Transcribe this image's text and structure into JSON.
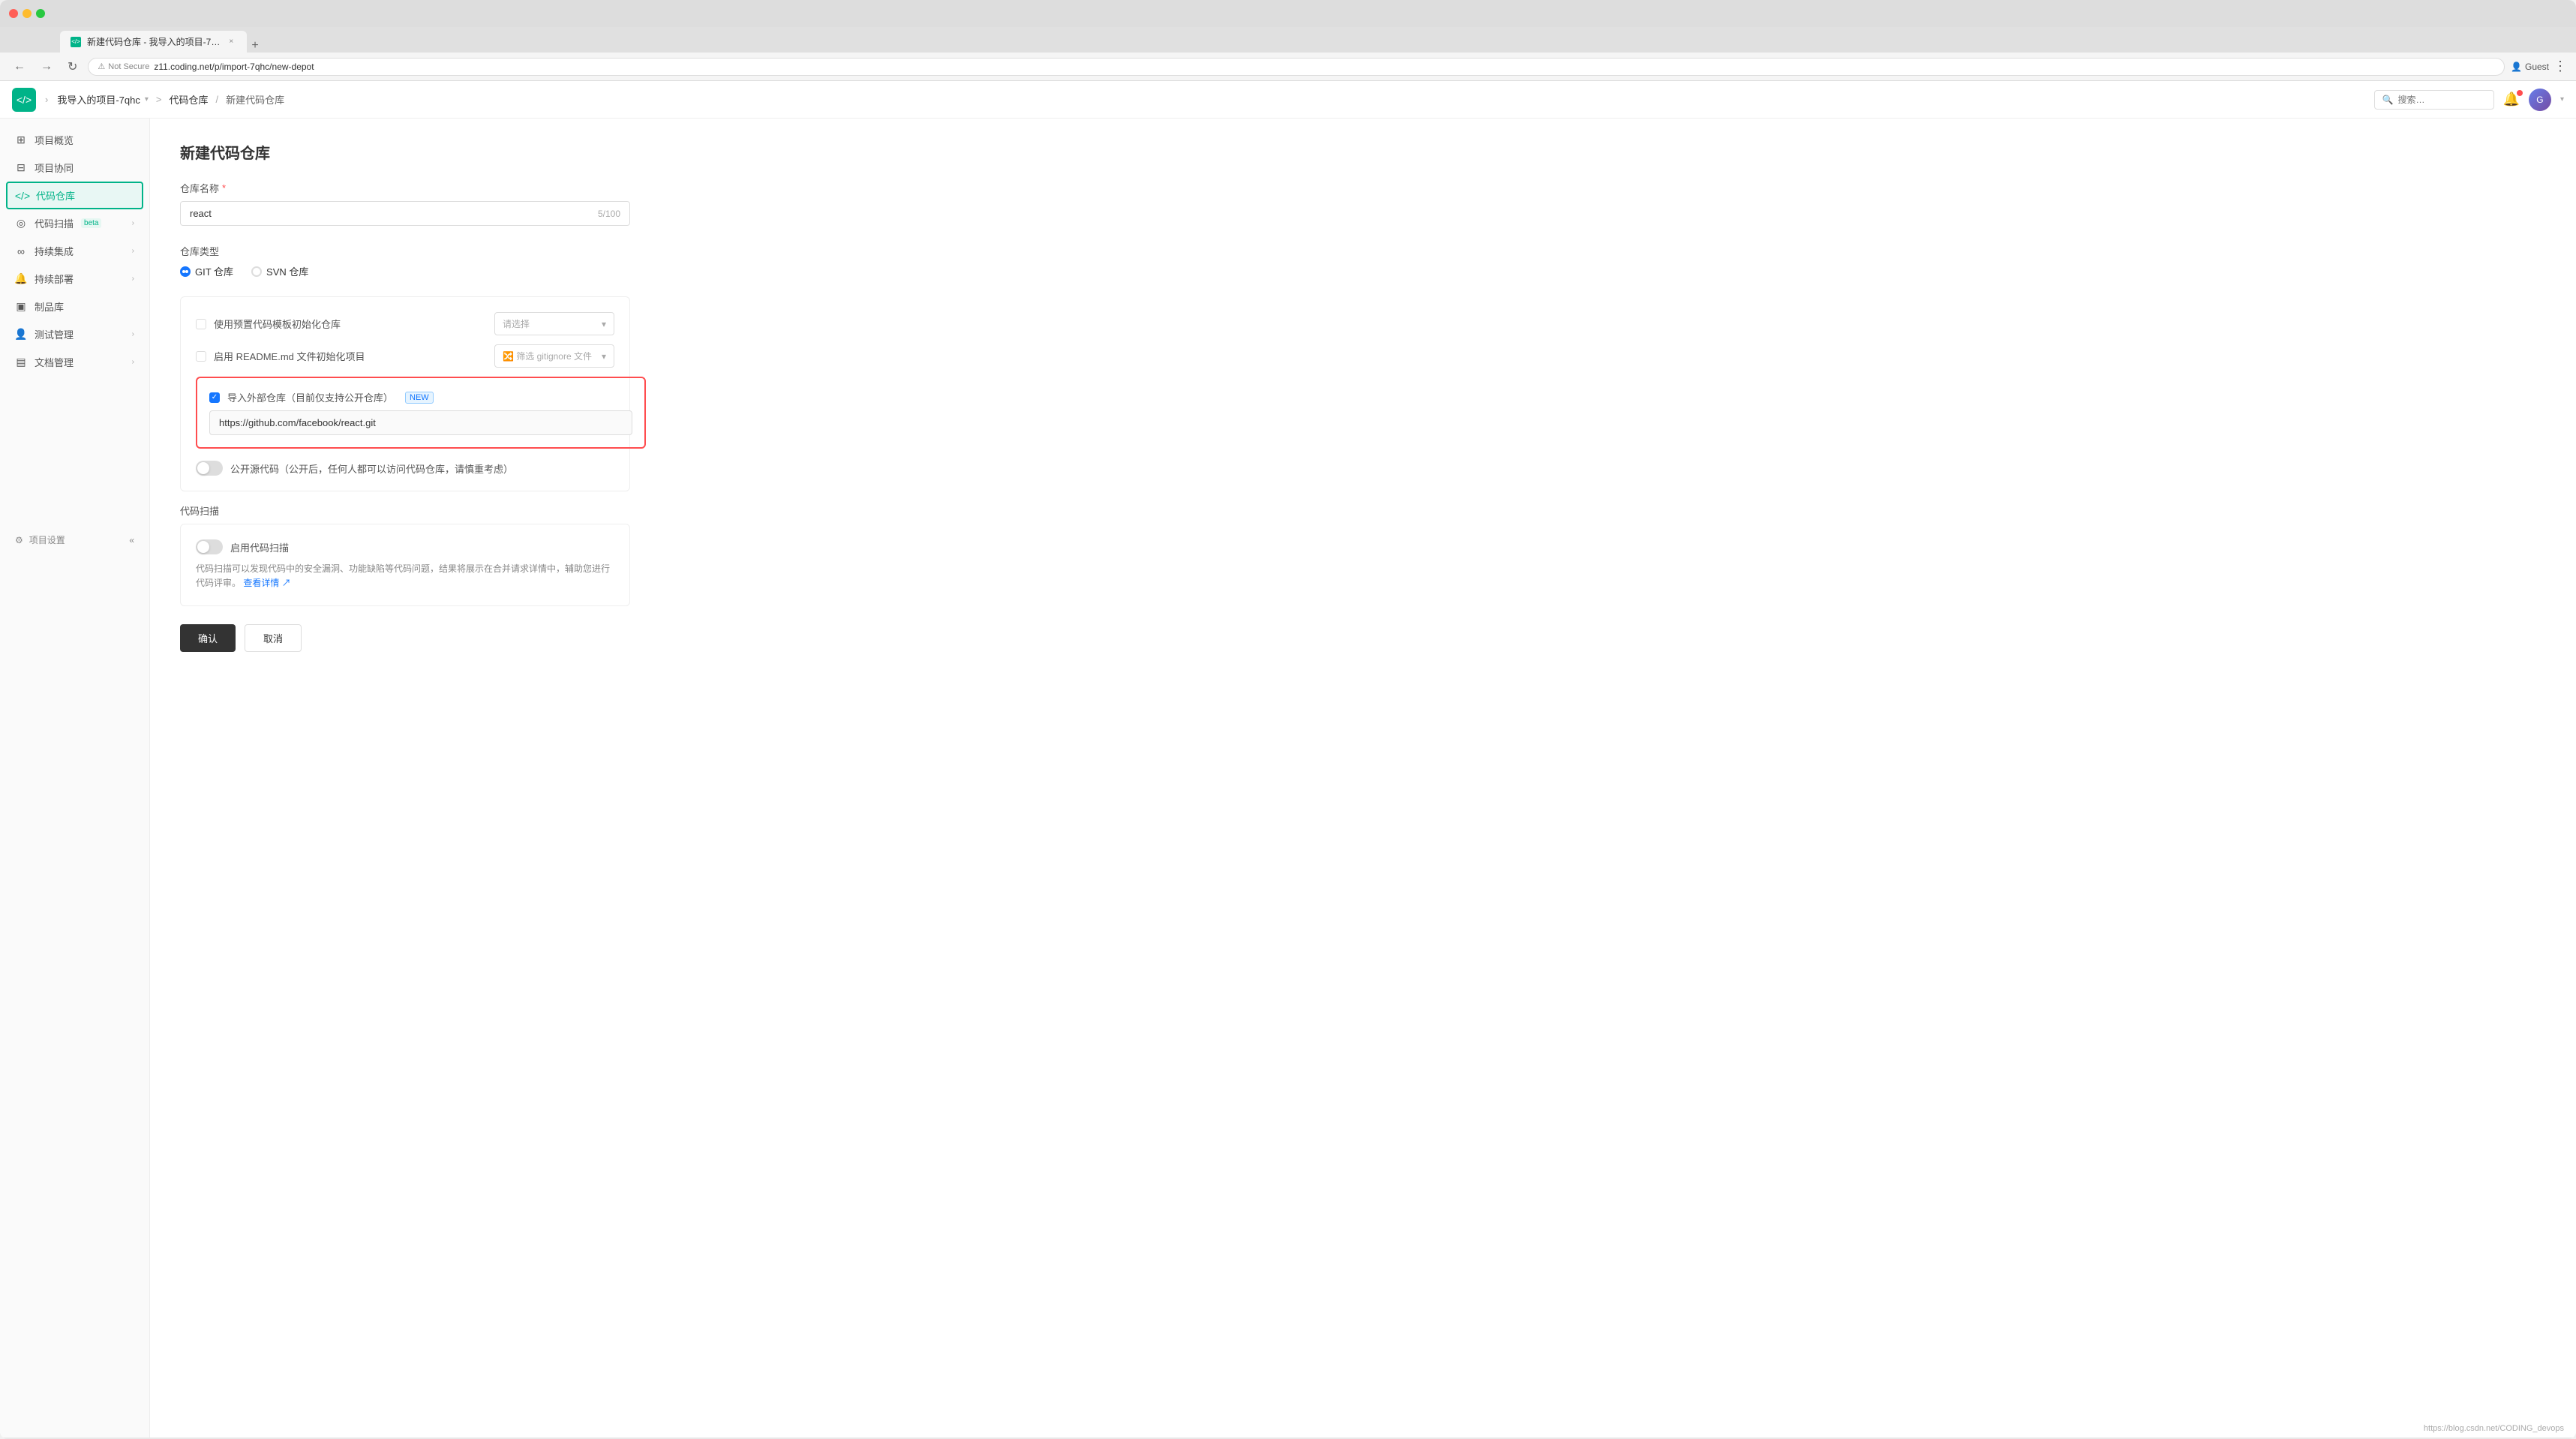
{
  "browser": {
    "tab_title": "新建代码仓库 - 我导入的项目-7…",
    "tab_close": "×",
    "tab_new": "+",
    "address_security": "Not Secure",
    "address_url": "z11.coding.net/p/import-7qhc/new-depot",
    "guest_label": "Guest",
    "more_icon": "⋮"
  },
  "header": {
    "logo_icon": "</>",
    "breadcrumb": {
      "project": "我导入的项目-7qhc",
      "sep1": ">",
      "section": "代码仓库",
      "sep2": "/",
      "current": "新建代码仓库"
    },
    "search_placeholder": "搜索…",
    "avatar_text": "G"
  },
  "sidebar": {
    "items": [
      {
        "id": "overview",
        "icon": "⊞",
        "label": "项目概览",
        "arrow": false,
        "beta": false
      },
      {
        "id": "collab",
        "icon": "⊟",
        "label": "项目协同",
        "arrow": false,
        "beta": false
      },
      {
        "id": "depot",
        "icon": "</>",
        "label": "代码仓库",
        "arrow": false,
        "active": true,
        "beta": false
      },
      {
        "id": "scan",
        "icon": "◎",
        "label": "代码扫描",
        "arrow": true,
        "beta": true
      },
      {
        "id": "ci",
        "icon": "∞",
        "label": "持续集成",
        "arrow": true,
        "beta": false
      },
      {
        "id": "cd",
        "icon": "🔔",
        "label": "持续部署",
        "arrow": true,
        "beta": false
      },
      {
        "id": "artifacts",
        "icon": "▣",
        "label": "制品库",
        "arrow": false,
        "beta": false
      },
      {
        "id": "test",
        "icon": "👤",
        "label": "测试管理",
        "arrow": true,
        "beta": false
      },
      {
        "id": "docs",
        "icon": "▤",
        "label": "文档管理",
        "arrow": true,
        "beta": false
      }
    ],
    "settings": {
      "icon": "⚙",
      "label": "项目设置",
      "collapse_icon": "«"
    }
  },
  "page": {
    "title": "新建代码仓库",
    "repo_name_label": "仓库名称",
    "required": "*",
    "repo_name_value": "react",
    "char_count": "5/100",
    "repo_type_label": "仓库类型",
    "repo_types": [
      {
        "id": "git",
        "label": "GIT 仓库",
        "checked": true
      },
      {
        "id": "svn",
        "label": "SVN 仓库",
        "checked": false
      }
    ],
    "options": {
      "template_checkbox": false,
      "template_label": "使用预置代码模板初始化仓库",
      "template_placeholder": "请选择",
      "readme_checkbox": false,
      "readme_label": "启用 README.md 文件初始化项目",
      "gitignore_label": "🔀 筛选 gitignore 文件",
      "import_checkbox": true,
      "import_label": "导入外部仓库（目前仅支持公开仓库）",
      "import_badge": "NEW",
      "import_url": "https://github.com/facebook/react.git",
      "public_toggle": false,
      "public_label": "公开源代码（公开后，任何人都可以访问代码仓库，请慎重考虑）"
    },
    "code_scan": {
      "section_label": "代码扫描",
      "toggle": false,
      "toggle_label": "启用代码扫描",
      "description": "代码扫描可以发现代码中的安全漏洞、功能缺陷等代码问题，结果将展示在合并请求详情中，辅助您进行代码评审。",
      "link_text": "查看详情",
      "link_icon": "↗"
    },
    "actions": {
      "confirm": "确认",
      "cancel": "取消"
    }
  },
  "footer": {
    "hint": "https://blog.csdn.net/CODING_devops"
  }
}
